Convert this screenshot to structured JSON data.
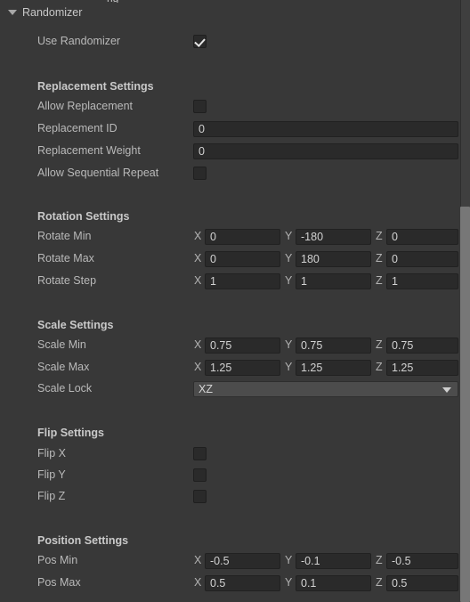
{
  "window": {
    "title": "Randomizer",
    "clipped_top_text": "ng",
    "foldout_expanded": true,
    "foldout_icon": "triangle-down-icon"
  },
  "colors": {
    "background": "#383838",
    "field_background": "#2a2a2a",
    "dropdown_background": "#4c4c4c",
    "label_text": "#b9b9b9",
    "header_text": "#c9c9c9",
    "value_text": "#d2d2d2",
    "scrollbar_thumb": "#777777",
    "scrollbar_track": "#3f3f3f"
  },
  "use_randomizer": {
    "label": "Use Randomizer",
    "checked": true
  },
  "sections": {
    "replacement": {
      "header": "Replacement Settings",
      "allow_replacement": {
        "label": "Allow Replacement",
        "checked": false
      },
      "replacement_id": {
        "label": "Replacement ID",
        "value": "0"
      },
      "replacement_weight": {
        "label": "Replacement Weight",
        "value": "0"
      },
      "allow_sequential_repeat": {
        "label": "Allow Sequential Repeat",
        "checked": false
      }
    },
    "rotation": {
      "header": "Rotation Settings",
      "rotate_min": {
        "label": "Rotate Min",
        "x": "0",
        "y": "-180",
        "z": "0"
      },
      "rotate_max": {
        "label": "Rotate Max",
        "x": "0",
        "y": "180",
        "z": "0"
      },
      "rotate_step": {
        "label": "Rotate Step",
        "x": "1",
        "y": "1",
        "z": "1"
      }
    },
    "scale": {
      "header": "Scale Settings",
      "scale_min": {
        "label": "Scale Min",
        "x": "0.75",
        "y": "0.75",
        "z": "0.75"
      },
      "scale_max": {
        "label": "Scale Max",
        "x": "1.25",
        "y": "1.25",
        "z": "1.25"
      },
      "scale_lock": {
        "label": "Scale Lock",
        "value": "XZ"
      }
    },
    "flip": {
      "header": "Flip Settings",
      "flip_x": {
        "label": "Flip X",
        "checked": false
      },
      "flip_y": {
        "label": "Flip Y",
        "checked": false
      },
      "flip_z": {
        "label": "Flip Z",
        "checked": false
      }
    },
    "position": {
      "header": "Position Settings",
      "pos_min": {
        "label": "Pos Min",
        "x": "-0.5",
        "y": "-0.1",
        "z": "-0.5"
      },
      "pos_max": {
        "label": "Pos Max",
        "x": "0.5",
        "y": "0.1",
        "z": "0.5"
      }
    }
  },
  "axes": {
    "x": "X",
    "y": "Y",
    "z": "Z"
  }
}
